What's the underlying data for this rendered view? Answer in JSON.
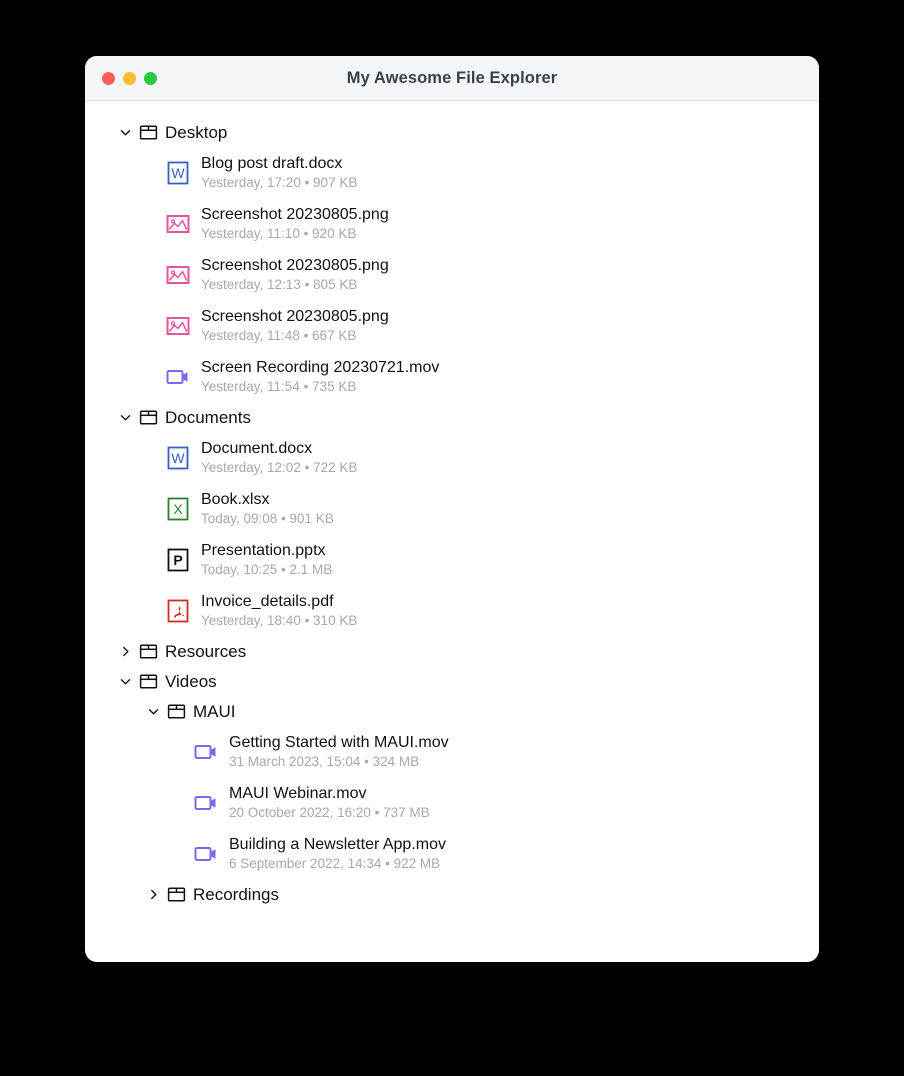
{
  "window": {
    "title": "My Awesome File Explorer",
    "traffic_lights": [
      {
        "name": "close",
        "color": "#ff5f57"
      },
      {
        "name": "minimize",
        "color": "#febc2e"
      },
      {
        "name": "maximize",
        "color": "#28c840"
      }
    ]
  },
  "colors": {
    "titlebar_bg": "#f4f7f9",
    "body_bg": "#ffffff",
    "text_primary": "#101114",
    "text_secondary": "#a6a8ad",
    "word_blue": "#3b5fc0",
    "excel_green": "#2e7d32",
    "powerpoint_black": "#111111",
    "pdf_red": "#d32b27",
    "image_pink": "#e8539e",
    "video_purple": "#7b68ee"
  },
  "tree": [
    {
      "type": "folder",
      "name": "Desktop",
      "depth": 0,
      "expanded": true,
      "chevron": "chevron-down-icon",
      "icon": "folder-icon"
    },
    {
      "type": "file",
      "name": "Blog post draft.docx",
      "meta": "Yesterday, 17:20 • 907 KB",
      "depth": 1,
      "icon": "word-file-icon"
    },
    {
      "type": "file",
      "name": "Screenshot 20230805.png",
      "meta": "Yesterday, 11:10 • 920 KB",
      "depth": 1,
      "icon": "image-file-icon"
    },
    {
      "type": "file",
      "name": "Screenshot 20230805.png",
      "meta": "Yesterday, 12:13 • 805 KB",
      "depth": 1,
      "icon": "image-file-icon"
    },
    {
      "type": "file",
      "name": "Screenshot 20230805.png",
      "meta": "Yesterday, 11:48 • 667 KB",
      "depth": 1,
      "icon": "image-file-icon"
    },
    {
      "type": "file",
      "name": "Screen Recording 20230721.mov",
      "meta": "Yesterday, 11:54 • 735 KB",
      "depth": 1,
      "icon": "video-file-icon"
    },
    {
      "type": "folder",
      "name": "Documents",
      "depth": 0,
      "expanded": true,
      "chevron": "chevron-down-icon",
      "icon": "folder-icon"
    },
    {
      "type": "file",
      "name": "Document.docx",
      "meta": "Yesterday, 12:02 • 722 KB",
      "depth": 1,
      "icon": "word-file-icon"
    },
    {
      "type": "file",
      "name": "Book.xlsx",
      "meta": "Today, 09:08 • 901 KB",
      "depth": 1,
      "icon": "excel-file-icon"
    },
    {
      "type": "file",
      "name": "Presentation.pptx",
      "meta": "Today, 10:25 • 2.1 MB",
      "depth": 1,
      "icon": "powerpoint-file-icon"
    },
    {
      "type": "file",
      "name": "Invoice_details.pdf",
      "meta": "Yesterday, 18:40 • 310 KB",
      "depth": 1,
      "icon": "pdf-file-icon"
    },
    {
      "type": "folder",
      "name": "Resources",
      "depth": 0,
      "expanded": false,
      "chevron": "chevron-right-icon",
      "icon": "folder-icon"
    },
    {
      "type": "folder",
      "name": "Videos",
      "depth": 0,
      "expanded": true,
      "chevron": "chevron-down-icon",
      "icon": "folder-icon"
    },
    {
      "type": "folder",
      "name": "MAUI",
      "depth": 1,
      "expanded": true,
      "chevron": "chevron-down-icon",
      "icon": "folder-icon"
    },
    {
      "type": "file",
      "name": "Getting Started with MAUI.mov",
      "meta": "31 March 2023, 15:04 • 324 MB",
      "depth": 2,
      "icon": "video-file-icon"
    },
    {
      "type": "file",
      "name": "MAUI Webinar.mov",
      "meta": "20 October 2022, 16:20 • 737 MB",
      "depth": 2,
      "icon": "video-file-icon"
    },
    {
      "type": "file",
      "name": "Building a Newsletter App.mov",
      "meta": "6 September 2022, 14:34 • 922 MB",
      "depth": 2,
      "icon": "video-file-icon"
    },
    {
      "type": "folder",
      "name": "Recordings",
      "depth": 1,
      "expanded": false,
      "chevron": "chevron-right-icon",
      "icon": "folder-icon"
    }
  ]
}
